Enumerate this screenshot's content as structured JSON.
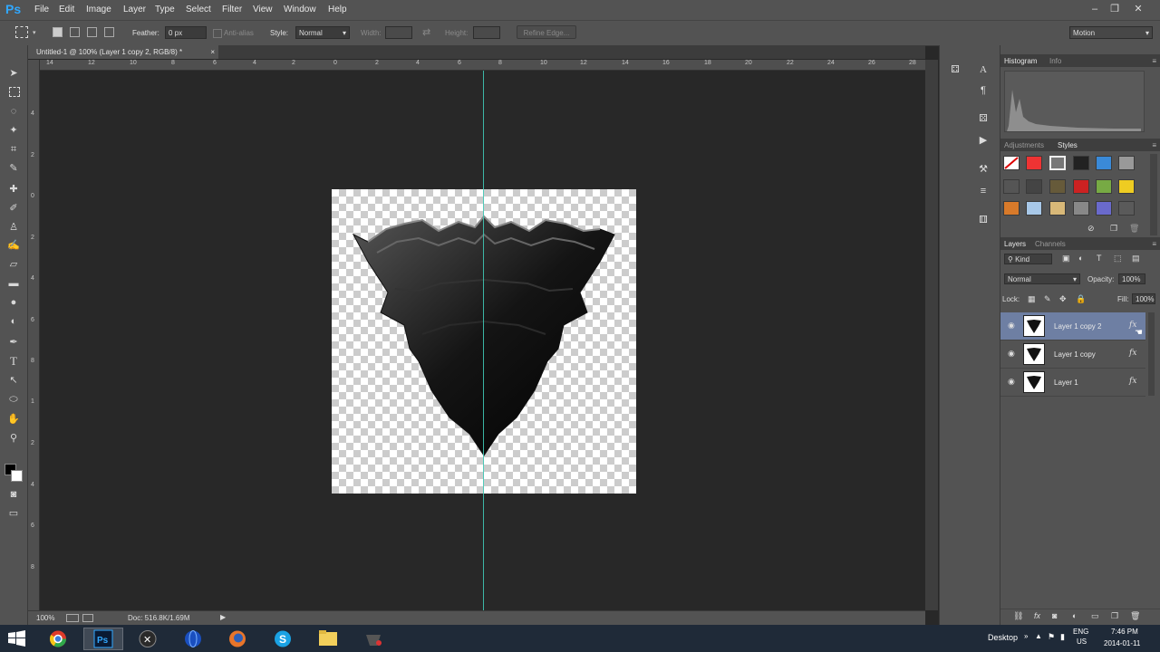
{
  "app": {
    "logo": "Ps"
  },
  "menu": [
    "File",
    "Edit",
    "Image",
    "Layer",
    "Type",
    "Select",
    "Filter",
    "View",
    "Window",
    "Help"
  ],
  "options": {
    "feather_label": "Feather:",
    "feather_value": "0 px",
    "antialias": "Anti-alias",
    "style_label": "Style:",
    "style_value": "Normal",
    "width_label": "Width:",
    "height_label": "Height:",
    "refine_edge": "Refine Edge...",
    "workspace": "Motion"
  },
  "document": {
    "tab_title": "Untitled-1 @ 100% (Layer 1 copy 2, RGB/8) *",
    "tab_close": "×",
    "ruler_top": [
      "14",
      "12",
      "10",
      "8",
      "6",
      "4",
      "2",
      "0",
      "2",
      "4",
      "6",
      "8",
      "10",
      "12",
      "14",
      "16",
      "18",
      "20",
      "22",
      "24",
      "26",
      "28"
    ],
    "ruler_left": [
      "4",
      "2",
      "0",
      "2",
      "4",
      "6",
      "8",
      "1",
      "2",
      "4",
      "6",
      "8"
    ],
    "zoom": "100%",
    "doc_size": "Doc: 516.8K/1.69M"
  },
  "panels": {
    "histogram_tab": "Histogram",
    "info_tab": "Info",
    "adjustments_tab": "Adjustments",
    "styles_tab": "Styles",
    "layers_tab": "Layers",
    "channels_tab": "Channels",
    "kind_filter": "Kind",
    "blend_mode": "Normal",
    "opacity_label": "Opacity:",
    "opacity_value": "100%",
    "lock_label": "Lock:",
    "fill_label": "Fill:",
    "fill_value": "100%",
    "fx_symbol": "fx",
    "layers": [
      {
        "name": "Layer 1 copy 2",
        "selected": true
      },
      {
        "name": "Layer 1 copy",
        "selected": false
      },
      {
        "name": "Layer 1",
        "selected": false
      }
    ]
  },
  "taskbar": {
    "desktop_label": "Desktop",
    "lang": "ENG",
    "region": "US",
    "time": "7:46 PM",
    "date": "2014-01-11"
  },
  "colors": {
    "accent": "#31a8ff",
    "guide": "#3fc7b4",
    "layer_selected": "#6e7fa3"
  }
}
